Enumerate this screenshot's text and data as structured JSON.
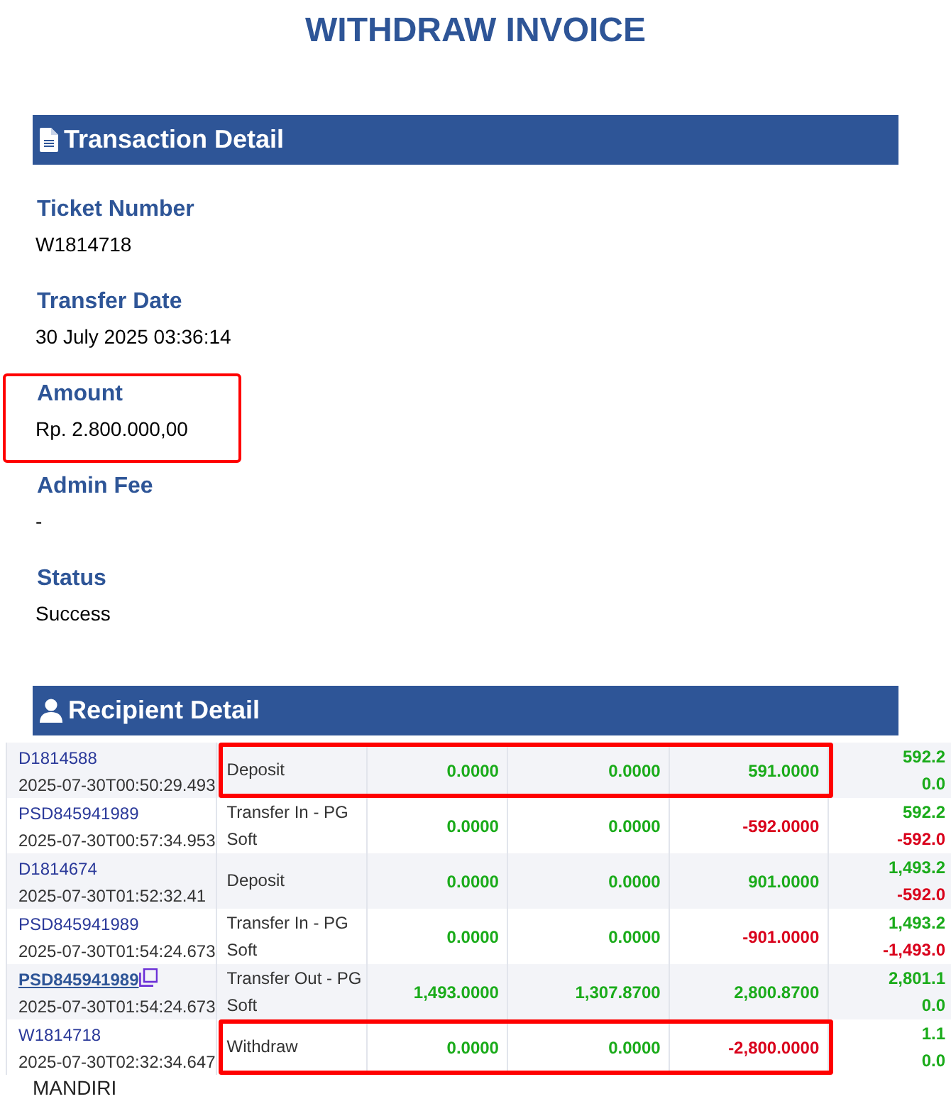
{
  "title": "WITHDRAW INVOICE",
  "transaction_detail": {
    "heading": "Transaction Detail",
    "fields": [
      {
        "label": "Ticket Number",
        "value": "W1814718",
        "highlighted": false
      },
      {
        "label": "Transfer Date",
        "value": "30 July 2025 03:36:14",
        "highlighted": false
      },
      {
        "label": "Amount",
        "value": "Rp. 2.800.000,00",
        "highlighted": true
      },
      {
        "label": "Admin Fee",
        "value": "-",
        "highlighted": false
      },
      {
        "label": "Status",
        "value": "Success",
        "highlighted": false
      }
    ]
  },
  "recipient_detail": {
    "heading": "Recipient Detail",
    "rows": [
      {
        "id": "D1814588",
        "link": false,
        "time": "2025-07-30T00:50:29.493",
        "type": "Deposit",
        "highlighted": true,
        "values": [
          {
            "text": "0.0000",
            "negative": false
          },
          {
            "text": "0.0000",
            "negative": false
          },
          {
            "text": "591.0000",
            "negative": false
          }
        ],
        "column_6": [
          {
            "text": "592.2",
            "negative": false
          },
          {
            "text": "0.0",
            "negative": false
          }
        ]
      },
      {
        "id": "PSD845941989",
        "link": false,
        "time": "2025-07-30T00:57:34.953",
        "type": "Transfer In - PG Soft",
        "highlighted": false,
        "values": [
          {
            "text": "0.0000",
            "negative": false
          },
          {
            "text": "0.0000",
            "negative": false
          },
          {
            "text": "-592.0000",
            "negative": true
          }
        ],
        "column_6": [
          {
            "text": "592.2",
            "negative": false
          },
          {
            "text": "-592.0",
            "negative": true
          }
        ]
      },
      {
        "id": "D1814674",
        "link": false,
        "time": "2025-07-30T01:52:32.41",
        "type": "Deposit",
        "highlighted": false,
        "values": [
          {
            "text": "0.0000",
            "negative": false
          },
          {
            "text": "0.0000",
            "negative": false
          },
          {
            "text": "901.0000",
            "negative": false
          }
        ],
        "column_6": [
          {
            "text": "1,493.2",
            "negative": false
          },
          {
            "text": "-592.0",
            "negative": true
          }
        ]
      },
      {
        "id": "PSD845941989",
        "link": false,
        "time": "2025-07-30T01:54:24.673",
        "type": "Transfer In - PG Soft",
        "highlighted": false,
        "values": [
          {
            "text": "0.0000",
            "negative": false
          },
          {
            "text": "0.0000",
            "negative": false
          },
          {
            "text": "-901.0000",
            "negative": true
          }
        ],
        "column_6": [
          {
            "text": "1,493.2",
            "negative": false
          },
          {
            "text": "-1,493.0",
            "negative": true
          }
        ]
      },
      {
        "id": "PSD845941989",
        "link": true,
        "time": "2025-07-30T01:54:24.673",
        "type": "Transfer Out - PG Soft",
        "highlighted": false,
        "values": [
          {
            "text": "1,493.0000",
            "negative": false
          },
          {
            "text": "1,307.8700",
            "negative": false
          },
          {
            "text": "2,800.8700",
            "negative": false
          }
        ],
        "column_6": [
          {
            "text": "2,801.1",
            "negative": false
          },
          {
            "text": "0.0",
            "negative": false
          }
        ]
      },
      {
        "id": "W1814718",
        "link": false,
        "time": "2025-07-30T02:32:34.647",
        "type": "Withdraw",
        "highlighted": true,
        "values": [
          {
            "text": "0.0000",
            "negative": false
          },
          {
            "text": "0.0000",
            "negative": false
          },
          {
            "text": "-2,800.0000",
            "negative": true
          }
        ],
        "column_6": [
          {
            "text": "1.1",
            "negative": false
          },
          {
            "text": "0.0",
            "negative": false
          }
        ]
      }
    ],
    "footer_text": "MANDIRI"
  }
}
